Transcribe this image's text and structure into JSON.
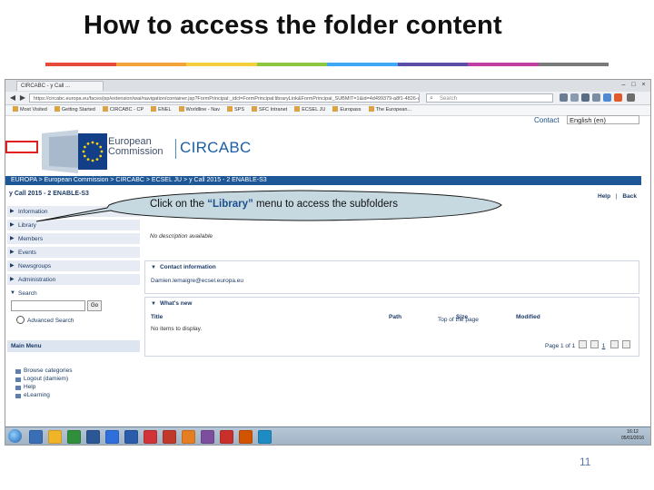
{
  "slide": {
    "title": "How to access the folder content",
    "page_number": "11",
    "deco_colors": [
      "#e64a3a",
      "#f2a33a",
      "#f4d03f",
      "#8dc63f",
      "#3fa9f5",
      "#5b4ea8",
      "#c03fa0",
      "#7a7a7a"
    ]
  },
  "browser": {
    "tab_title": "CIRCABC - y Call ...",
    "url": "https://circabc.europa.eu/faces/jsp/extension/wai/navigation/container.jsp?FormPrincipal:_idcl=FormPrincipal:libraryLink&FormPrincipal_SUBMIT=1&id=4d499379-a8f1-4826-a575-5e75d4e95eb6&javax.faces.ViewState=...",
    "search_placeholder": "Search",
    "bookmarks": [
      "Most Visited",
      "Getting Started",
      "CIRCABC - CP",
      "ENEL",
      "Worldline - Nav",
      "SPS",
      "SFC Intranet",
      "ECSEL JU",
      "Europass",
      "The European..."
    ]
  },
  "header": {
    "contact": "Contact",
    "language": "English (en)",
    "ec_name_line1": "European",
    "ec_name_line2": "Commission",
    "app_name": "CIRCABC"
  },
  "breadcrumb": "EUROPA > European Commission > CIRCABC > ECSEL JU > y Call 2015 - 2 ENABLE-S3",
  "space": {
    "name": "y Call 2015 - 2 ENABLE-S3",
    "help": "Help",
    "separator": "|",
    "back": "Back"
  },
  "sidebar": {
    "items": [
      {
        "label": "Information"
      },
      {
        "label": "Library"
      },
      {
        "label": "Members"
      },
      {
        "label": "Events"
      },
      {
        "label": "Newsgroups"
      },
      {
        "label": "Administration"
      },
      {
        "label": "Search"
      }
    ],
    "go_label": "Go",
    "advanced_search": "Advanced Search",
    "main_menu_title": "Main Menu",
    "main_menu_items": [
      {
        "label": "Browse categories"
      },
      {
        "label": "Logout (damiem)"
      },
      {
        "label": "Help"
      },
      {
        "label": "eLearning"
      }
    ]
  },
  "main": {
    "description": "No description available",
    "contact_title": "Contact information",
    "contact_email": "Damien.lemaigre@ecsel.europa.eu",
    "whats_new_title": "What's new",
    "columns": [
      "Title",
      "Path",
      "Size",
      "Modified"
    ],
    "no_items": "No items to display.",
    "pager": "Page 1 of 1",
    "pager_current": "1",
    "top_of_page": "Top of the page"
  },
  "callout": {
    "prefix": "Click on the ",
    "highlight": "“Library”",
    "suffix": " menu to access the subfolders"
  },
  "taskbar": {
    "time": "16:12",
    "date": "05/01/2016",
    "icon_colors": [
      "#3a6fb5",
      "#f0b429",
      "#2f8f3a",
      "#2b5797",
      "#2e6fdc",
      "#2a5cab",
      "#d13438",
      "#c0392b",
      "#e67e22",
      "#7e4e9e",
      "#c9302c",
      "#d35400",
      "#1e8bc3"
    ]
  }
}
